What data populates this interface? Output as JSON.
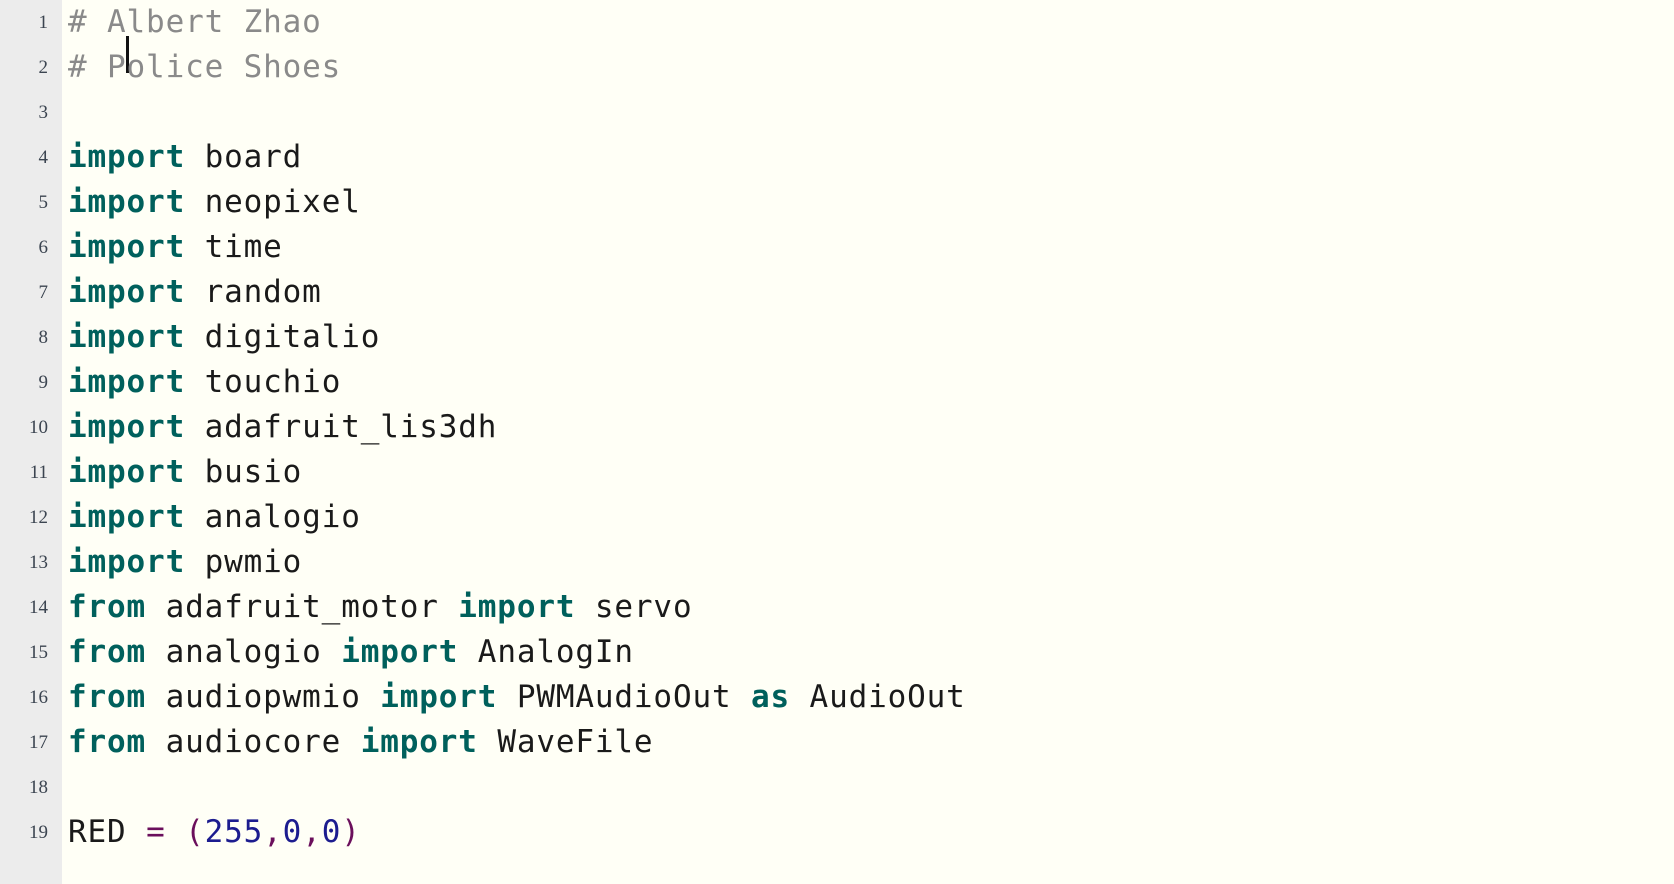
{
  "editor": {
    "background_color": "#fffff6",
    "gutter_color": "#ececec",
    "gutter_text_color": "#3b4450",
    "caret_line": 1,
    "caret_column": 4,
    "colors": {
      "comment": "#8a8a8a",
      "keyword": "#00605c",
      "plain": "#1a1a1a",
      "number": "#1c1c8f",
      "operator": "#6b0f5c"
    }
  },
  "lines": [
    {
      "number": "1",
      "tokens": [
        {
          "t": "# A",
          "k": "comment"
        },
        {
          "t": "",
          "k": "caret"
        },
        {
          "t": "lbert Zhao",
          "k": "comment"
        }
      ]
    },
    {
      "number": "2",
      "tokens": [
        {
          "t": "# Police Shoes",
          "k": "comment"
        }
      ]
    },
    {
      "number": "3",
      "tokens": []
    },
    {
      "number": "4",
      "tokens": [
        {
          "t": "import",
          "k": "keyword"
        },
        {
          "t": " board",
          "k": "plain"
        }
      ]
    },
    {
      "number": "5",
      "tokens": [
        {
          "t": "import",
          "k": "keyword"
        },
        {
          "t": " neopixel",
          "k": "plain"
        }
      ]
    },
    {
      "number": "6",
      "tokens": [
        {
          "t": "import",
          "k": "keyword"
        },
        {
          "t": " time",
          "k": "plain"
        }
      ]
    },
    {
      "number": "7",
      "tokens": [
        {
          "t": "import",
          "k": "keyword"
        },
        {
          "t": " random",
          "k": "plain"
        }
      ]
    },
    {
      "number": "8",
      "tokens": [
        {
          "t": "import",
          "k": "keyword"
        },
        {
          "t": " digitalio",
          "k": "plain"
        }
      ]
    },
    {
      "number": "9",
      "tokens": [
        {
          "t": "import",
          "k": "keyword"
        },
        {
          "t": " touchio",
          "k": "plain"
        }
      ]
    },
    {
      "number": "10",
      "tokens": [
        {
          "t": "import",
          "k": "keyword"
        },
        {
          "t": " adafruit_lis3dh",
          "k": "plain"
        }
      ]
    },
    {
      "number": "11",
      "tokens": [
        {
          "t": "import",
          "k": "keyword"
        },
        {
          "t": " busio",
          "k": "plain"
        }
      ]
    },
    {
      "number": "12",
      "tokens": [
        {
          "t": "import",
          "k": "keyword"
        },
        {
          "t": " analogio",
          "k": "plain"
        }
      ]
    },
    {
      "number": "13",
      "tokens": [
        {
          "t": "import",
          "k": "keyword"
        },
        {
          "t": " pwmio",
          "k": "plain"
        }
      ]
    },
    {
      "number": "14",
      "tokens": [
        {
          "t": "from",
          "k": "keyword"
        },
        {
          "t": " adafruit_motor ",
          "k": "plain"
        },
        {
          "t": "import",
          "k": "keyword"
        },
        {
          "t": " servo",
          "k": "plain"
        }
      ]
    },
    {
      "number": "15",
      "tokens": [
        {
          "t": "from",
          "k": "keyword"
        },
        {
          "t": " analogio ",
          "k": "plain"
        },
        {
          "t": "import",
          "k": "keyword"
        },
        {
          "t": " AnalogIn",
          "k": "plain"
        }
      ]
    },
    {
      "number": "16",
      "tokens": [
        {
          "t": "from",
          "k": "keyword"
        },
        {
          "t": " audiopwmio ",
          "k": "plain"
        },
        {
          "t": "import",
          "k": "keyword"
        },
        {
          "t": " PWMAudioOut ",
          "k": "plain"
        },
        {
          "t": "as",
          "k": "keyword"
        },
        {
          "t": " AudioOut",
          "k": "plain"
        }
      ]
    },
    {
      "number": "17",
      "tokens": [
        {
          "t": "from",
          "k": "keyword"
        },
        {
          "t": " audiocore ",
          "k": "plain"
        },
        {
          "t": "import",
          "k": "keyword"
        },
        {
          "t": " WaveFile",
          "k": "plain"
        }
      ]
    },
    {
      "number": "18",
      "tokens": []
    },
    {
      "number": "19",
      "tokens": [
        {
          "t": "RED ",
          "k": "plain"
        },
        {
          "t": "=",
          "k": "operator"
        },
        {
          "t": " ",
          "k": "plain"
        },
        {
          "t": "(",
          "k": "operator"
        },
        {
          "t": "255",
          "k": "number"
        },
        {
          "t": ",",
          "k": "operator"
        },
        {
          "t": "0",
          "k": "number"
        },
        {
          "t": ",",
          "k": "operator"
        },
        {
          "t": "0",
          "k": "number"
        },
        {
          "t": ")",
          "k": "operator"
        }
      ]
    }
  ]
}
